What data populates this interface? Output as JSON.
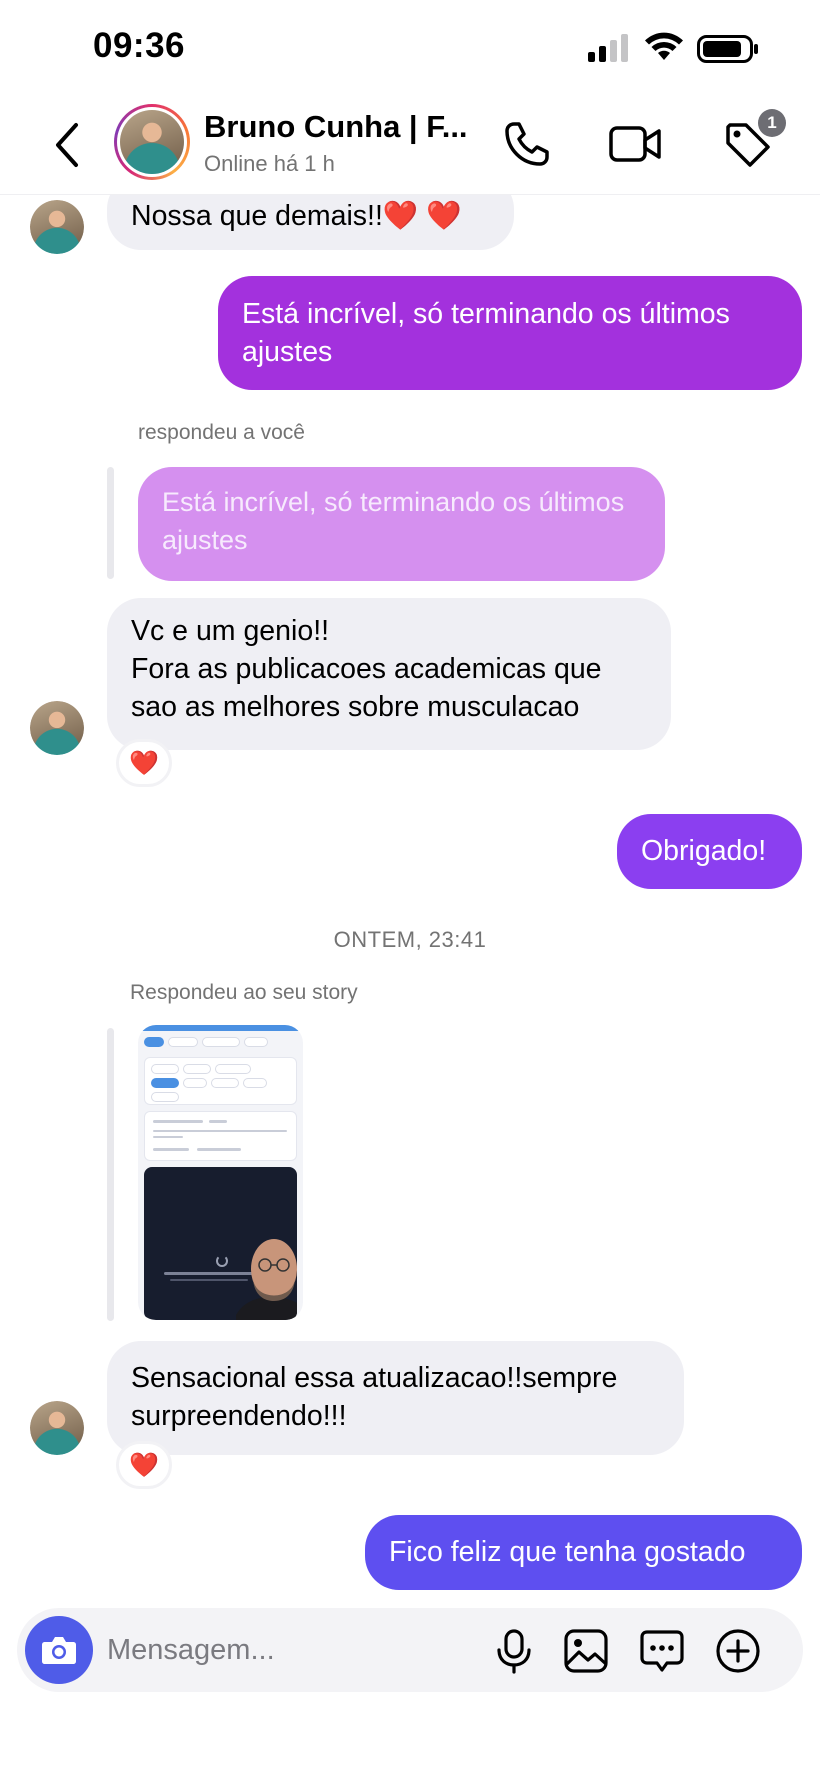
{
  "status_bar": {
    "time": "09:36"
  },
  "header": {
    "name": "Bruno Cunha | F...",
    "status": "Online há 1 h",
    "tag_badge": "1"
  },
  "messages": {
    "m1": {
      "text": "Nossa que demais!!❤️ ❤️"
    },
    "m2": {
      "text": "Está incrível, só terminando os últimos ajustes"
    },
    "m3_reply_label": "respondeu a você",
    "m3_quote": "Está incrível, só terminando os últimos ajustes",
    "m3_line1": "Vc e um genio!!",
    "m3_line2": "Fora as publicacoes academicas que sao as melhores sobre musculacao",
    "m3_reaction": "❤️",
    "m4": {
      "text": "Obrigado!"
    },
    "date_separator": "ONTEM, 23:41",
    "m5_reply_label": "Respondeu ao seu story",
    "m5_text": "Sensacional essa atualizacao!!sempre surpreendendo!!!",
    "m5_reaction": "❤️",
    "m6": {
      "text": "Fico feliz que tenha gostado"
    }
  },
  "colors": {
    "outgoing_1": "#a331dd",
    "outgoing_2": "#8b3ff0",
    "outgoing_3": "#5e4ff0",
    "incoming": "#efeff4",
    "camera_button": "#4f5ce8"
  },
  "composer": {
    "placeholder": "Mensagem..."
  }
}
